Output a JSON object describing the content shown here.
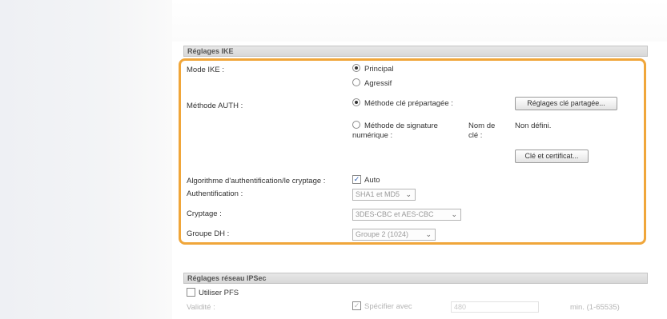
{
  "ike": {
    "header": "Réglages IKE",
    "mode_label": "Mode IKE :",
    "mode_options": [
      "Principal",
      "Agressif"
    ],
    "auth_label": "Méthode AUTH :",
    "auth_psk": "Méthode clé prépartagée :",
    "auth_psk_button": "Réglages clé partagée...",
    "auth_digital_sig_line1": "Méthode de signature",
    "auth_digital_sig_line2": "numérique :",
    "key_name_label_line1": "Nom de",
    "key_name_label_line2": "clé :",
    "key_name_value": "Non défini.",
    "key_cert_button": "Clé et certificat...",
    "algo_label": "Algorithme d'authentification/le cryptage :",
    "algo_auto_label": "Auto",
    "authentication_label": "Authentification :",
    "authentication_value": "SHA1 et MD5",
    "encryption_label": "Cryptage :",
    "encryption_value": "3DES-CBC et AES-CBC",
    "dh_label": "Groupe DH :",
    "dh_value": "Groupe 2 (1024)"
  },
  "ipsec": {
    "header": "Réglages réseau IPSec",
    "pfs_label": "Utiliser PFS",
    "validity_label": "Validité :",
    "specify_label": "Spécifier avec",
    "validity_value": "480",
    "validity_unit": "min. (1-65535)"
  }
}
